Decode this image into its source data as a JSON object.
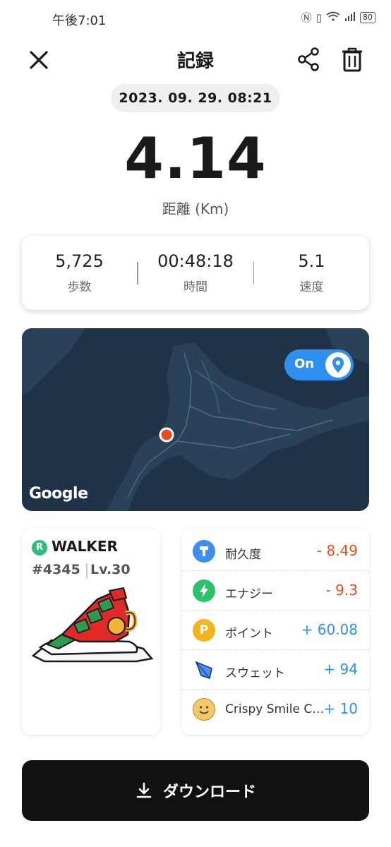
{
  "status_bar": {
    "time": "午後7:01",
    "battery": "80"
  },
  "header": {
    "title": "記録"
  },
  "record": {
    "datetime": "2023. 09. 29. 08:21",
    "distance": "4.14",
    "distance_label": "距離 (Km)"
  },
  "stats": [
    {
      "value": "5,725",
      "label": "歩数"
    },
    {
      "value": "00:48:18",
      "label": "時間"
    },
    {
      "value": "5.1",
      "label": "速度"
    }
  ],
  "map": {
    "toggle_label": "On",
    "provider": "Google"
  },
  "nft": {
    "badge": "R",
    "type": "WALKER",
    "id": "#4345",
    "level": "Lv.30"
  },
  "rewards": [
    {
      "label": "耐久度",
      "value": "- 8.49",
      "icon": "durability-icon",
      "color": "#3d8ef0"
    },
    {
      "label": "エナジー",
      "value": "- 9.3",
      "icon": "energy-icon",
      "color": "#2cc16b"
    },
    {
      "label": "ポイント",
      "value": "+ 60.08",
      "icon": "point-icon",
      "color": "#f2b51f"
    },
    {
      "label": "スウェット",
      "value": "+ 94",
      "icon": "sweat-icon",
      "color": "#3b7de0"
    },
    {
      "label": "Crispy Smile C…",
      "value": "+ 10",
      "icon": "smile-icon",
      "color": "#f3c86a"
    }
  ],
  "download": {
    "label": "ダウンロード"
  }
}
